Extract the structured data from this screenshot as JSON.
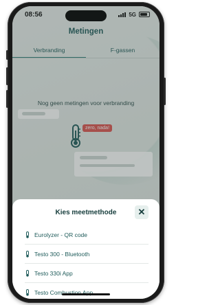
{
  "status_bar": {
    "time": "08:56",
    "network": "5G"
  },
  "header": {
    "title": "Metingen"
  },
  "tabs": [
    {
      "label": "Verbranding",
      "active": true
    },
    {
      "label": "F-gassen",
      "active": false
    }
  ],
  "empty_state": {
    "message": "Nog geen metingen voor verbranding",
    "badge": "zero, nada!"
  },
  "sheet": {
    "title": "Kies meetmethode",
    "options": [
      {
        "label": "Eurolyzer - QR code",
        "icon": "thermometer-icon"
      },
      {
        "label": "Testo 300 - Bluetooth",
        "icon": "thermometer-icon"
      },
      {
        "label": "Testo 330i App",
        "icon": "thermometer-icon"
      },
      {
        "label": "Testo Combustion App",
        "icon": "thermometer-icon"
      }
    ]
  },
  "colors": {
    "accent": "#1f5b5a",
    "badge": "#d9534f"
  }
}
